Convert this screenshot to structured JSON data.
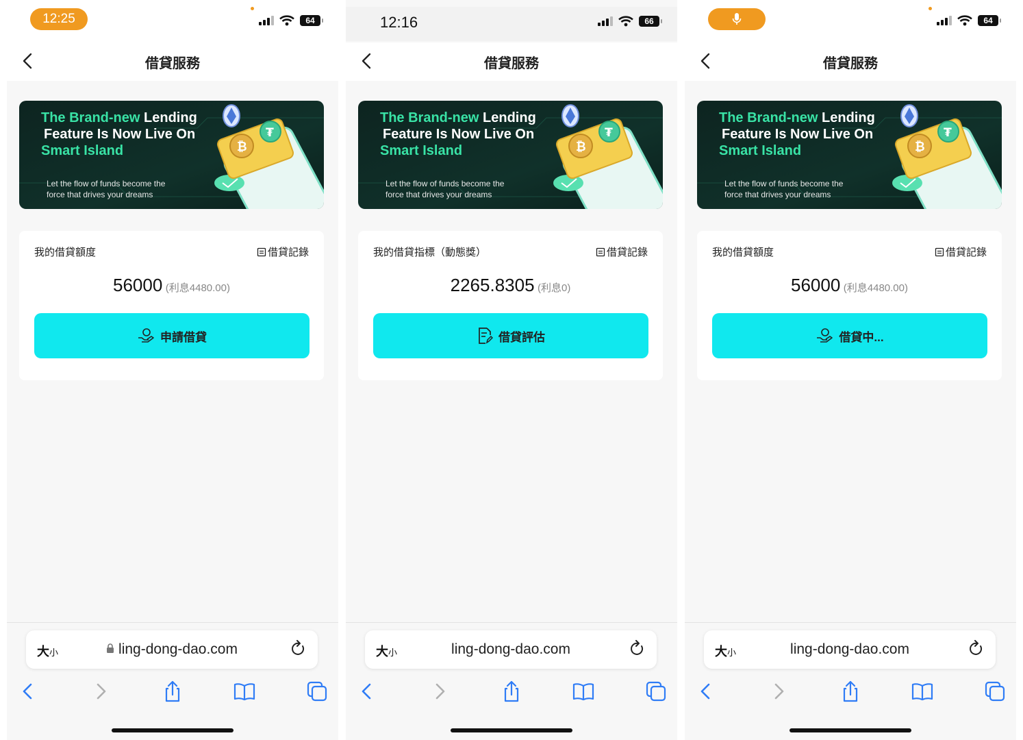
{
  "colors": {
    "accent_button": "#10e8ee",
    "status_pill": "#f09a20",
    "banner_green": "#39e3a6",
    "banner_bg": "#0f2a26"
  },
  "screens": [
    {
      "status": {
        "time": "12:25",
        "time_style": "orange-pill",
        "battery": "64"
      },
      "nav": {
        "title": "借貸服務",
        "back_icon": "chevron-left-icon"
      },
      "banner": {
        "line1_green": "The Brand-new",
        "line1_white": "Lending",
        "line2": "Feature Is Now Live On",
        "line3": "Smart Island",
        "sub1": "Let the flow of funds become the",
        "sub2": "force that drives your dreams"
      },
      "card": {
        "label": "我的借貸額度",
        "record_label": "借貸記錄",
        "amount": "56000",
        "interest": "(利息4480.00)",
        "button_label": "申請借貸",
        "button_icon": "hand-coin-icon"
      },
      "browser": {
        "text_size": "大",
        "text_size_small": "小",
        "url": "ling-dong-dao.com",
        "secure": true
      }
    },
    {
      "status": {
        "time": "12:16",
        "time_style": "plain",
        "battery": "66"
      },
      "nav": {
        "title": "借貸服務",
        "back_icon": "chevron-left-icon"
      },
      "banner": {
        "line1_green": "The Brand-new",
        "line1_white": "Lending",
        "line2": "Feature Is Now Live On",
        "line3": "Smart Island",
        "sub1": "Let the flow of funds become the",
        "sub2": "force that drives your dreams"
      },
      "card": {
        "label": "我的借貸指標（動態獎）",
        "record_label": "借貸記錄",
        "amount": "2265.8305",
        "interest": "(利息0)",
        "button_label": "借貸評估",
        "button_icon": "document-edit-icon"
      },
      "browser": {
        "text_size": "大",
        "text_size_small": "小",
        "url": "ling-dong-dao.com",
        "secure": false
      }
    },
    {
      "status": {
        "time": "",
        "time_style": "mic-pill",
        "battery": "64"
      },
      "nav": {
        "title": "借貸服務",
        "back_icon": "chevron-left-icon"
      },
      "banner": {
        "line1_green": "The Brand-new",
        "line1_white": "Lending",
        "line2": "Feature Is Now Live On",
        "line3": "Smart Island",
        "sub1": "Let the flow of funds become the",
        "sub2": "force that drives your dreams"
      },
      "card": {
        "label": "我的借貸額度",
        "record_label": "借貸記錄",
        "amount": "56000",
        "interest": "(利息4480.00)",
        "button_label": "借貸中...",
        "button_icon": "hand-coin-icon"
      },
      "browser": {
        "text_size": "大",
        "text_size_small": "小",
        "url": "ling-dong-dao.com",
        "secure": false
      }
    }
  ]
}
